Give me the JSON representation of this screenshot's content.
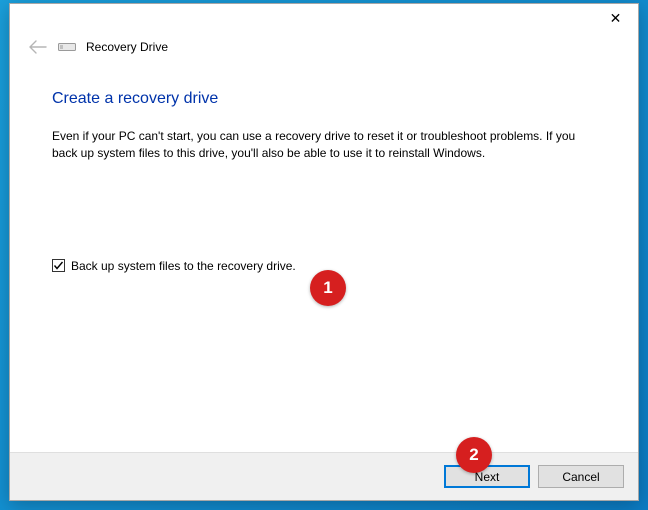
{
  "titlebar": {
    "close_glyph": "✕"
  },
  "header": {
    "window_title": "Recovery Drive"
  },
  "content": {
    "heading": "Create a recovery drive",
    "description": "Even if your PC can't start, you can use a recovery drive to reset it or troubleshoot problems. If you back up system files to this drive, you'll also be able to use it to reinstall Windows.",
    "checkbox_label": "Back up system files to the recovery drive.",
    "checkbox_checked": true
  },
  "footer": {
    "next_label": "Next",
    "cancel_label": "Cancel"
  },
  "annotations": {
    "badge1": "1",
    "badge2": "2"
  }
}
